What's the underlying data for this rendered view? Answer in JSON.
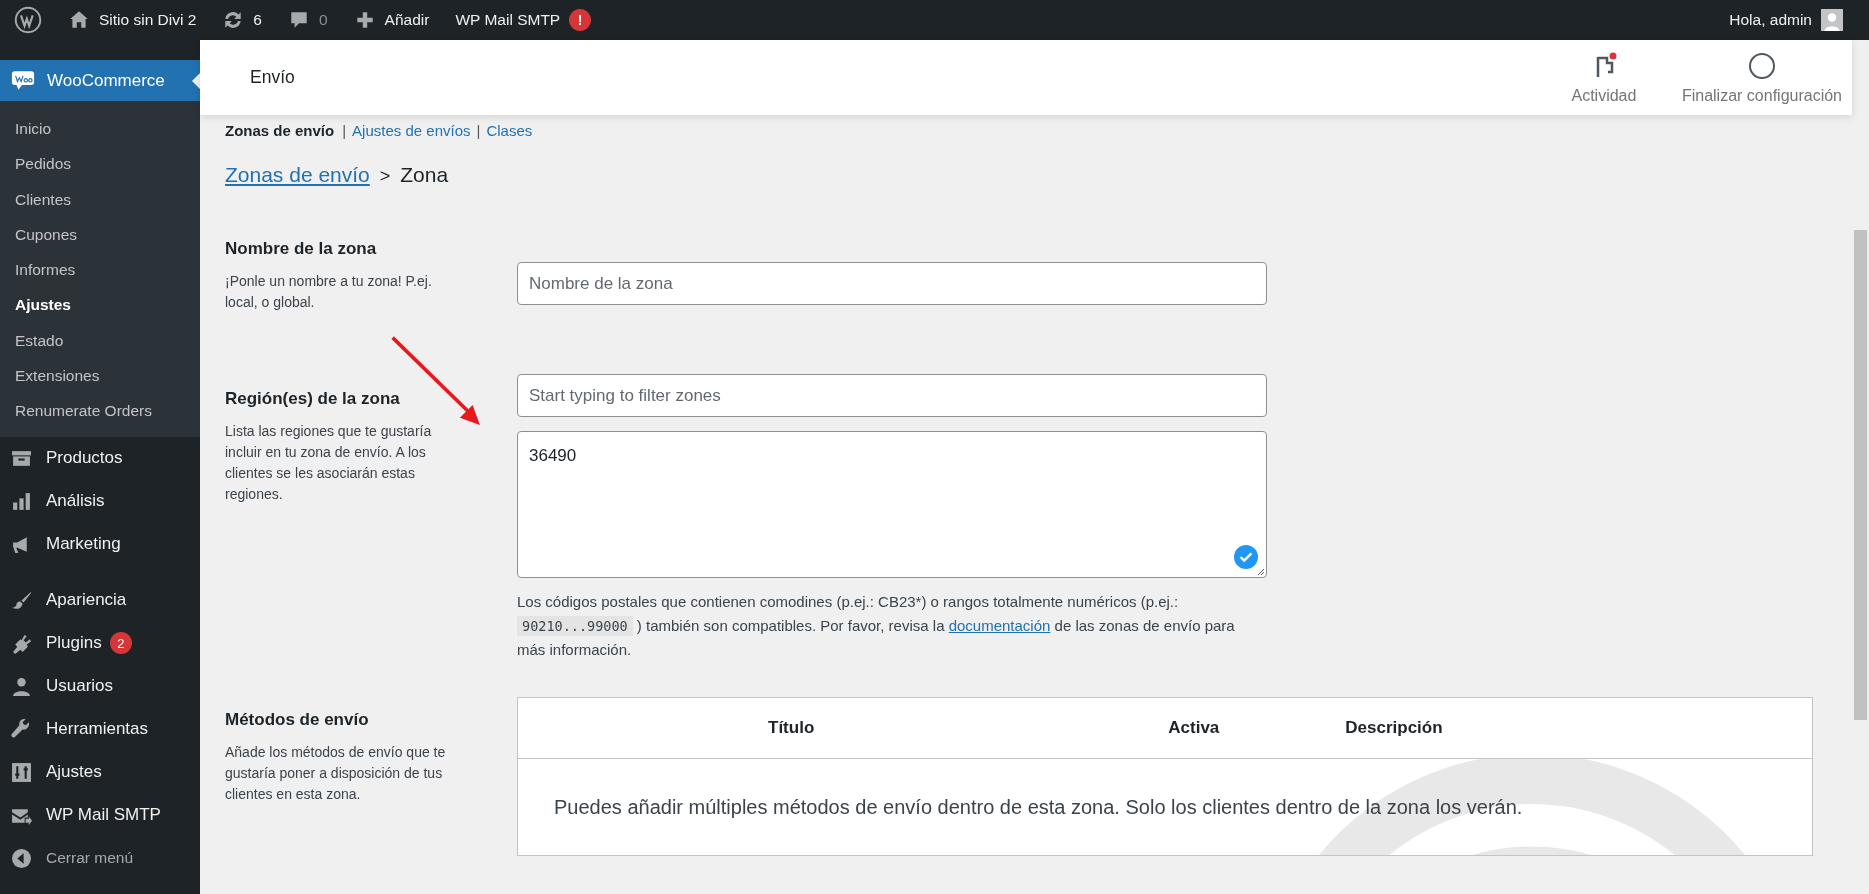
{
  "admin_bar": {
    "items": [
      {
        "kind": "wp"
      },
      {
        "kind": "home",
        "label": "Sitio sin Divi 2"
      },
      {
        "kind": "updates",
        "label": "6"
      },
      {
        "kind": "comments",
        "label": "0"
      },
      {
        "kind": "new",
        "label": "Añadir"
      },
      {
        "kind": "text",
        "label": "WP Mail SMTP",
        "badge": "!"
      }
    ],
    "greeting": "Hola, admin"
  },
  "sidebar": {
    "current": {
      "label": "WooCommerce",
      "selected": true
    },
    "submenu": [
      {
        "label": "Inicio",
        "selected": false
      },
      {
        "label": "Pedidos",
        "selected": false
      },
      {
        "label": "Clientes",
        "selected": false
      },
      {
        "label": "Cupones",
        "selected": false
      },
      {
        "label": "Informes",
        "selected": false
      },
      {
        "label": "Ajustes",
        "selected": true
      },
      {
        "label": "Estado",
        "selected": false
      },
      {
        "label": "Extensiones",
        "selected": false
      },
      {
        "label": "Renumerate Orders",
        "selected": false
      }
    ],
    "menu": [
      {
        "kind": "archive",
        "label": "Productos"
      },
      {
        "kind": "chart",
        "label": "Análisis"
      },
      {
        "kind": "megaphone",
        "label": "Marketing"
      },
      {
        "kind": "brush",
        "label": "Apariencia"
      },
      {
        "kind": "plug",
        "label": "Plugins",
        "badge": "2"
      },
      {
        "kind": "user",
        "label": "Usuarios"
      },
      {
        "kind": "wrench",
        "label": "Herramientas"
      },
      {
        "kind": "sliders",
        "label": "Ajustes"
      },
      {
        "kind": "mail",
        "label": "WP Mail SMTP"
      },
      {
        "kind": "collapse",
        "label": "Cerrar menú"
      }
    ]
  },
  "header": {
    "title": "Envío",
    "actions": [
      {
        "kind": "activity",
        "label": "Actividad",
        "notification": true
      },
      {
        "kind": "setup",
        "label": "Finalizar configuración"
      }
    ]
  },
  "subnav": [
    {
      "label": "Zonas de envío",
      "selected": true
    },
    {
      "label": "Ajustes de envíos",
      "selected": false,
      "divider": "|"
    },
    {
      "label": "Clases",
      "selected": false,
      "divider": "|"
    }
  ],
  "breadcrumb": {
    "link": "Zonas de envío",
    "separator": ">",
    "current": "Zona"
  },
  "zone_name": {
    "title": "Nombre de la zona",
    "description": "¡Ponle un nombre a tu zona! P.ej. local, o global.",
    "placeholder": "Nombre de la zona"
  },
  "regions": {
    "title": "Región(es) de la zona",
    "description": "Lista las regiones que te gustaría incluir en tu zona de envío. A los clientes se les asociarán estas regiones.",
    "placeholder": "Start typing to filter zones",
    "value": "36490",
    "valid": true,
    "help": {
      "before": "Los códigos postales que contienen comodines (p.ej.: CB23*) o rangos totalmente numéricos (p.ej.: ",
      "code": "90210...99000",
      "middle": " ) también son compatibles. Por favor, revisa la ",
      "link": "documentación",
      "after": " de las zonas de envío para más información."
    }
  },
  "methods": {
    "title": "Métodos de envío",
    "description": "Añade los métodos de envío que te gustaría poner a disposición de tus clientes en esta zona.",
    "columns": [
      "Título",
      "Activa",
      "Descripción"
    ],
    "empty": "Puedes añadir múltiples métodos de envío dentro de esta zona. Solo los clientes dentro de la zona los verán."
  }
}
